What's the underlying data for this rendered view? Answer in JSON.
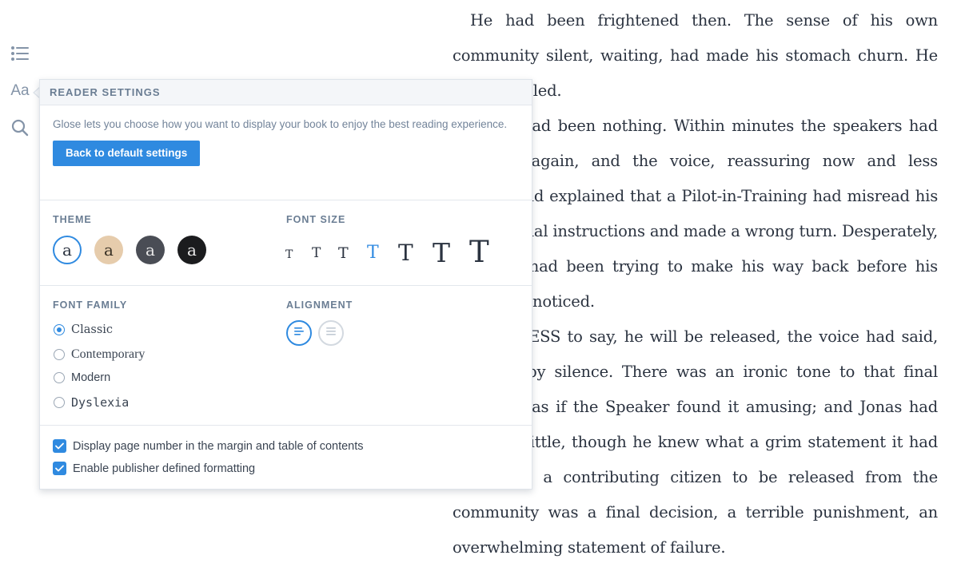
{
  "toolbar": {
    "aa_label": "Aa",
    "icons": [
      "table-of-contents-icon",
      "font-settings-icon",
      "search-icon"
    ]
  },
  "book": {
    "paragraphs": [
      "He had been frightened then. The sense of his own community silent, waiting, had made his stomach churn. He had trembled.",
      "But it had been nothing. Within minutes the speakers had crackled again, and the voice, reassuring now and less urgent, had explained that a Pilot-in-Training had misread his navigational instructions and made a wrong turn. Desperately, the pilot had been trying to make his way back before his error was noticed.",
      "NEEDLESS to say, he will be released, the voice had said, followed by silence. There was an ironic tone to that final message, as if the Speaker found it amusing; and Jonas had smiled a little, though he knew what a grim statement it had been. For a contributing citizen to be released from the community was a final decision, a terrible punishment, an overwhelming statement of failure."
    ]
  },
  "settings": {
    "header": "READER SETTINGS",
    "intro": "Glose lets you choose how you want to display your book to enjoy the best reading experience.",
    "reset_button": "Back to default settings",
    "theme": {
      "label": "THEME",
      "swatch_glyph": "a",
      "swatches": [
        {
          "name": "white",
          "bg": "#ffffff",
          "fg": "#2b3340",
          "selected": true
        },
        {
          "name": "sepia",
          "bg": "#e6ccac",
          "fg": "#3a3226",
          "selected": false
        },
        {
          "name": "gray",
          "bg": "#4a4d55",
          "fg": "#e8e8e8",
          "selected": false
        },
        {
          "name": "black",
          "bg": "#1b1c1e",
          "fg": "#e8e8e8",
          "selected": false
        }
      ]
    },
    "font_size": {
      "label": "FONT SIZE",
      "glyph": "T",
      "selected_index": 3
    },
    "font_family": {
      "label": "FONT FAMILY",
      "options": [
        {
          "label": "Classic",
          "selected": true
        },
        {
          "label": "Contemporary",
          "selected": false
        },
        {
          "label": "Modern",
          "selected": false
        },
        {
          "label": "Dyslexia",
          "selected": false
        }
      ]
    },
    "alignment": {
      "label": "ALIGNMENT",
      "options": [
        {
          "name": "align-left",
          "selected": true
        },
        {
          "name": "justify",
          "selected": false
        }
      ]
    },
    "checkboxes": [
      {
        "label": "Display page number in the margin and table of contents",
        "checked": true
      },
      {
        "label": "Enable publisher defined formatting",
        "checked": true
      }
    ]
  },
  "colors": {
    "accent": "#2f8ae0",
    "label": "#6a7d93",
    "text": "#2b3340"
  }
}
